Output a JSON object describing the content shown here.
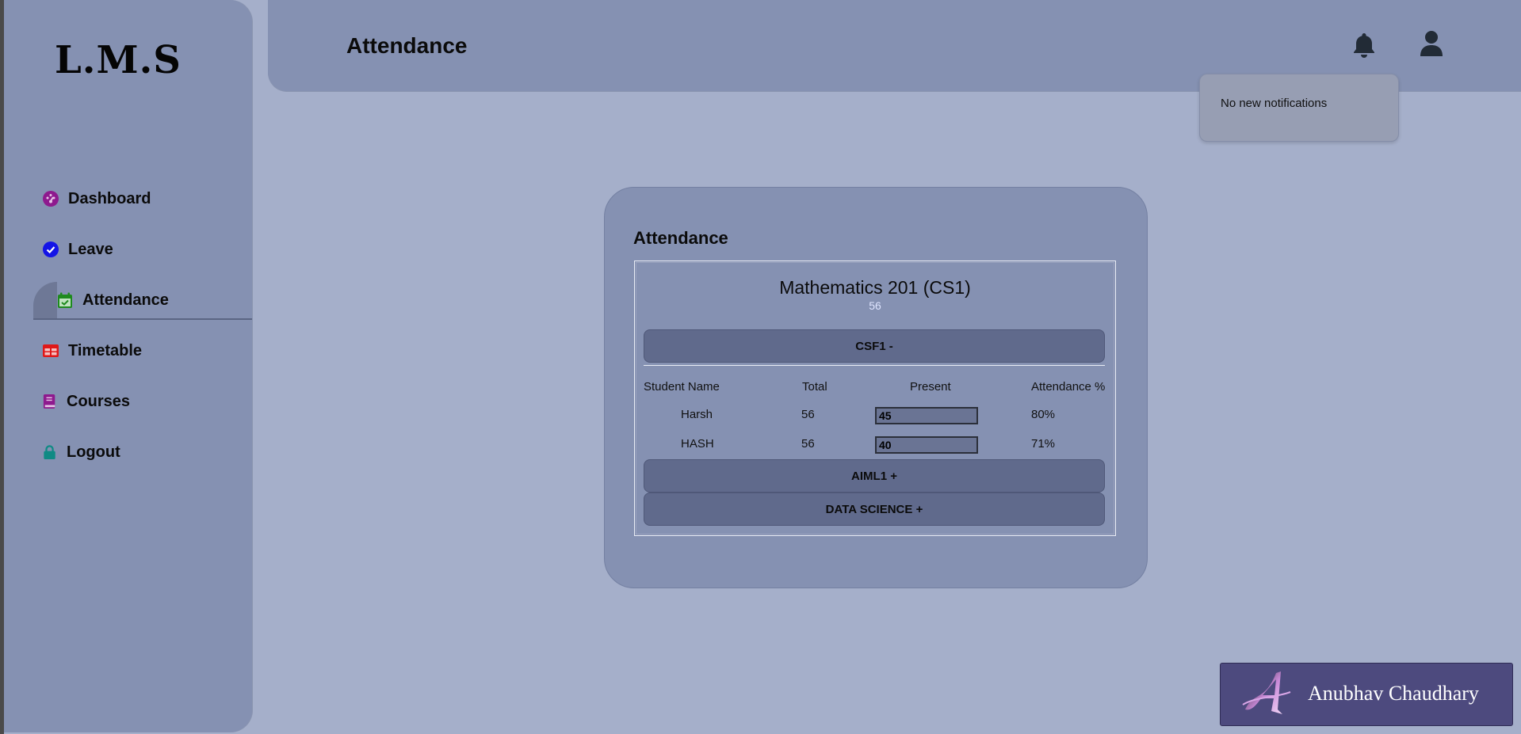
{
  "app": {
    "logo": "L.M.S"
  },
  "sidebar": {
    "items": [
      {
        "label": "Dashboard",
        "icon": "dashboard-icon",
        "color": "#8e1a8e"
      },
      {
        "label": "Leave",
        "icon": "check-circle-icon",
        "color": "#1414e6"
      },
      {
        "label": "Attendance",
        "icon": "calendar-check-icon",
        "color": "#1e8a1e",
        "active": true
      },
      {
        "label": "Timetable",
        "icon": "table-icon",
        "color": "#e01818"
      },
      {
        "label": "Courses",
        "icon": "book-icon",
        "color": "#8e1a8e"
      },
      {
        "label": "Logout",
        "icon": "lock-icon",
        "color": "#0f8a84"
      }
    ]
  },
  "header": {
    "title": "Attendance",
    "icons": [
      "bell-icon",
      "user-icon"
    ],
    "notification_text": "No new notifications"
  },
  "main": {
    "card_title": "Attendance",
    "course": {
      "name": "Mathematics 201 (CS1)",
      "total": "56",
      "sections": [
        {
          "label": "CSF1 -",
          "expanded": true
        },
        {
          "label": "AIML1 +",
          "expanded": false
        },
        {
          "label": "DATA SCIENCE +",
          "expanded": false
        }
      ],
      "columns": [
        "Student Name",
        "Total",
        "Present",
        "Attendance %"
      ],
      "rows": [
        {
          "name": "Harsh",
          "total": "56",
          "present": "45",
          "percent": "80%"
        },
        {
          "name": "HASH",
          "total": "56",
          "present": "40",
          "percent": "71%"
        }
      ]
    }
  },
  "badge": {
    "name": "Anubhav Chaudhary",
    "monogram": "A"
  }
}
